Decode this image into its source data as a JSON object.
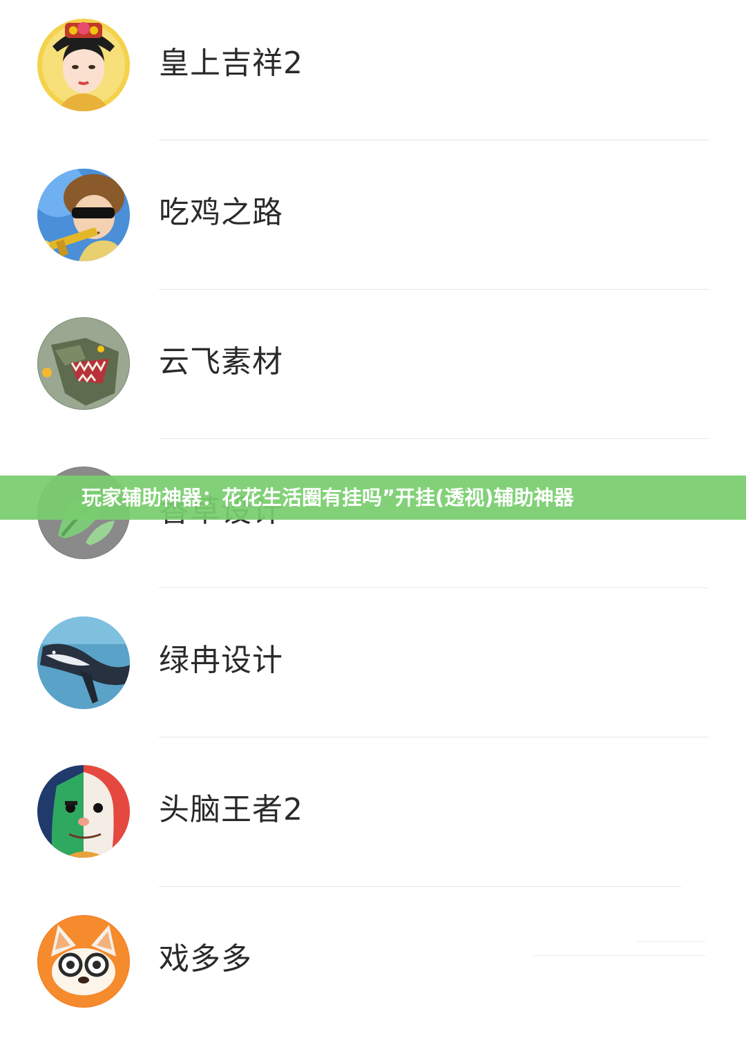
{
  "list": {
    "items": [
      {
        "name": "皇上吉祥2",
        "icon": "empress-avatar-icon"
      },
      {
        "name": "吃鸡之路",
        "icon": "soldier-cartoon-avatar-icon"
      },
      {
        "name": "云飞素材",
        "icon": "dragon-avatar-icon"
      },
      {
        "name": "香草设计",
        "icon": "green-leaf-avatar-icon"
      },
      {
        "name": "绿冉设计",
        "icon": "whale-avatar-icon"
      },
      {
        "name": "头脑王者2",
        "icon": "split-face-avatar-icon"
      },
      {
        "name": "戏多多",
        "icon": "fox-avatar-icon"
      }
    ]
  },
  "banner": {
    "text": "玩家辅助神器：花花生活圈有挂吗”开挂(透视)辅助神器",
    "color": "#78cd6e"
  }
}
